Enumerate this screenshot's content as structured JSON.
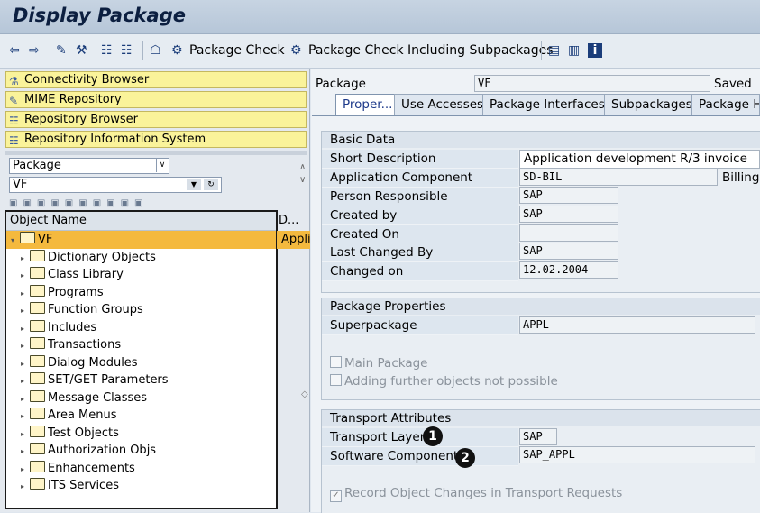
{
  "window": {
    "title": "Display Package"
  },
  "toolbar": {
    "package_check_label": "Package Check",
    "package_check_sub_label": "Package Check Including Subpackages"
  },
  "nav": {
    "items": [
      {
        "label": "Connectivity Browser"
      },
      {
        "label": "MIME Repository"
      },
      {
        "label": "Repository Browser"
      },
      {
        "label": "Repository Information System"
      }
    ],
    "object_type_value": "Package",
    "object_name_value": "VF"
  },
  "tree": {
    "col_name": "Object Name",
    "col_desc": "D...",
    "root": {
      "label": "VF",
      "desc": "Appli"
    },
    "children": [
      "Dictionary Objects",
      "Class Library",
      "Programs",
      "Function Groups",
      "Includes",
      "Transactions",
      "Dialog Modules",
      "SET/GET Parameters",
      "Message Classes",
      "Area Menus",
      "Test Objects",
      "Authorization Objs",
      "Enhancements",
      "ITS Services"
    ]
  },
  "header": {
    "package_label": "Package",
    "package_value": "VF",
    "status": "Saved"
  },
  "tabs": [
    "Proper...",
    "Use Accesses",
    "Package Interfaces",
    "Subpackages",
    "Package Hi"
  ],
  "basic_data": {
    "title": "Basic Data",
    "short_description": {
      "label": "Short Description",
      "value": "Application development R/3 invoice"
    },
    "application_component": {
      "label": "Application Component",
      "value": "SD-BIL",
      "extra": "Billing"
    },
    "person_responsible": {
      "label": "Person Responsible",
      "value": "SAP"
    },
    "created_by": {
      "label": "Created by",
      "value": "SAP"
    },
    "created_on": {
      "label": "Created On",
      "value": ""
    },
    "last_changed_by": {
      "label": "Last Changed By",
      "value": "SAP"
    },
    "changed_on": {
      "label": "Changed on",
      "value": "12.02.2004"
    }
  },
  "package_properties": {
    "title": "Package Properties",
    "superpackage": {
      "label": "Superpackage",
      "value": "APPL"
    },
    "main_package_label": "Main Package",
    "adding_objects_label": "Adding further objects not possible"
  },
  "transport": {
    "title": "Transport Attributes",
    "transport_layer": {
      "label": "Transport Layer",
      "value": "SAP"
    },
    "software_component": {
      "label": "Software Component",
      "value": "SAP_APPL"
    },
    "record_changes_label": "Record Object Changes in Transport Requests"
  },
  "callouts": [
    "1",
    "2"
  ]
}
